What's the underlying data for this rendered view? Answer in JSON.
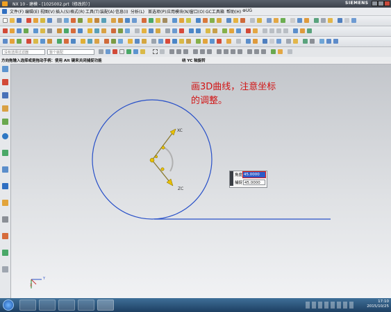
{
  "window": {
    "title": "NX 10 - 建模 - [1025002.prt（修改的）]",
    "brand": "SIEMENS"
  },
  "menubar": {
    "items": [
      "文件(F)",
      "编辑(E)",
      "视图(V)",
      "插入(S)",
      "格式(R)",
      "工具(T)",
      "装配(A)",
      "信息(I)",
      "分析(L)",
      "首选项(P)",
      "应用模块(N)",
      "窗口(O)",
      "GC工具箱",
      "帮助(H)",
      "⊕UG"
    ]
  },
  "selection_bar": {
    "filter_label": "没有选择过滤器",
    "scope_label": "整个装配"
  },
  "cue_line": {
    "prompt": "方向拖输入选择或是拖动手柄：使用 Alt 键来关闭捕捉功能",
    "status": "绕 YC 轴旋转"
  },
  "annotation": {
    "line1": "画3D曲线，注意坐标",
    "line2": "的调整。",
    "color": "#d21414"
  },
  "handles": {
    "xc": "XC",
    "zc": "ZC"
  },
  "angle_dialog": {
    "angle_label": "角度",
    "angle_value": "45.0000",
    "snap_label": "捕捉",
    "snap_value": "45.0000"
  },
  "triad": {
    "y": "Y",
    "x": "X"
  },
  "taskbar": {
    "time": "17:10",
    "date": "2015/10/25"
  },
  "colors": {
    "curve": "#2850c8",
    "accent": "#d21414",
    "handle": "#e8c000"
  }
}
